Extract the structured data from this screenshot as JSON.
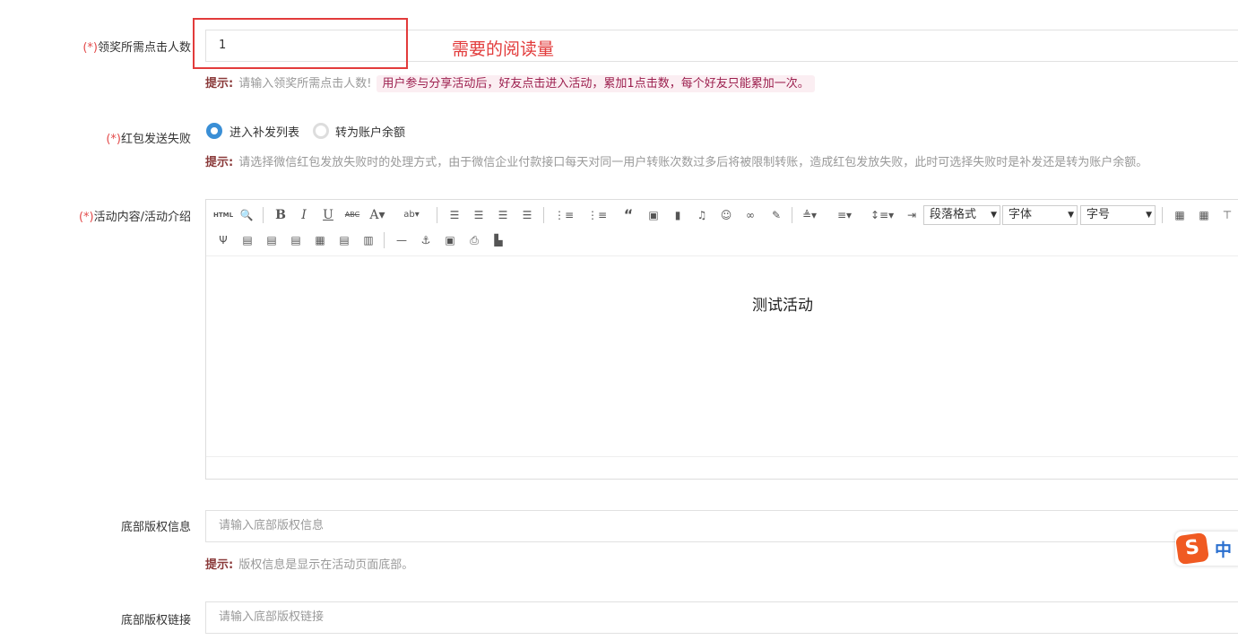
{
  "fields": {
    "clicks": {
      "req": "(*)",
      "label": "领奖所需点击人数",
      "value": "1",
      "hint_prefix": "提示:",
      "hint": "请输入领奖所需点击人数!",
      "hint_pill": "用户参与分享活动后，好友点击进入活动，累加1点击数，每个好友只能累加一次。"
    },
    "redpacket_fail": {
      "req": "(*)",
      "label": "红包发送失败",
      "option_1": "进入补发列表",
      "option_2": "转为账户余额",
      "selected": "进入补发列表",
      "hint_prefix": "提示:",
      "hint": "请选择微信红包发放失败时的处理方式，由于微信企业付款接口每天对同一用户转账次数过多后将被限制转账，造成红包发放失败，此时可选择失败时是补发还是转为账户余额。"
    },
    "content": {
      "req": "(*)",
      "label": "活动内容/活动介绍",
      "body": "测试活动",
      "select_paragraph": "段落格式",
      "select_font": "字体",
      "select_size": "字号"
    },
    "copyright_info": {
      "label": "底部版权信息",
      "placeholder": "请输入底部版权信息",
      "hint_prefix": "提示:",
      "hint": "版权信息是显示在活动页面底部。"
    },
    "copyright_link": {
      "label": "底部版权链接",
      "placeholder": "请输入底部版权链接"
    }
  },
  "annotation": "需要的阅读量",
  "ime": {
    "label": "中"
  },
  "colors": {
    "required": "#e34a4a",
    "annotation": "#e23b3b",
    "radio": "#3a8fd6",
    "pill_bg": "#fbeef2"
  }
}
